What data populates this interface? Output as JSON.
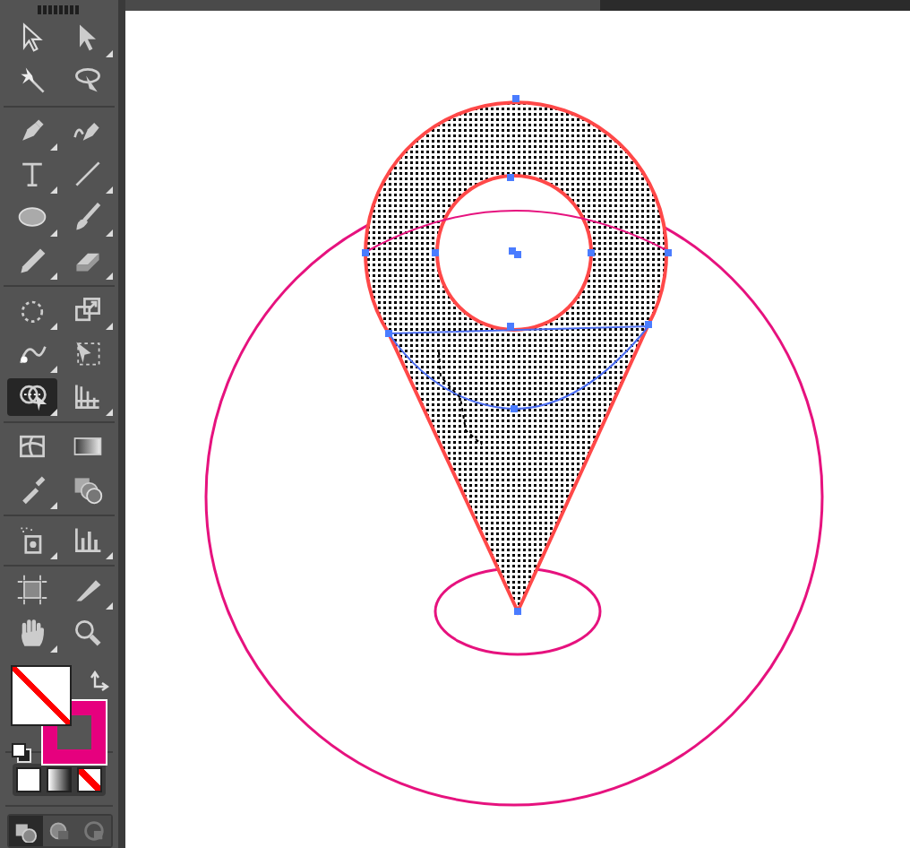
{
  "tool_groups": [
    [
      {
        "kind": "selection",
        "selected": false,
        "flyout": false
      },
      {
        "kind": "direct-selection",
        "selected": false,
        "flyout": true
      },
      {
        "kind": "magic-wand",
        "selected": false,
        "flyout": false
      },
      {
        "kind": "lasso",
        "selected": false,
        "flyout": false
      }
    ],
    [
      {
        "kind": "pen",
        "selected": false,
        "flyout": true
      },
      {
        "kind": "curvature",
        "selected": false,
        "flyout": false
      },
      {
        "kind": "type",
        "selected": false,
        "flyout": true
      },
      {
        "kind": "line",
        "selected": false,
        "flyout": true
      },
      {
        "kind": "ellipse",
        "selected": false,
        "flyout": true
      },
      {
        "kind": "brush",
        "selected": false,
        "flyout": true
      },
      {
        "kind": "pencil",
        "selected": false,
        "flyout": true
      },
      {
        "kind": "eraser",
        "selected": false,
        "flyout": true
      }
    ],
    [
      {
        "kind": "rotate",
        "selected": false,
        "flyout": true
      },
      {
        "kind": "scale",
        "selected": false,
        "flyout": true
      },
      {
        "kind": "puppet-warp",
        "selected": false,
        "flyout": true
      },
      {
        "kind": "free-transform",
        "selected": false,
        "flyout": false
      },
      {
        "kind": "shape-builder",
        "selected": true,
        "flyout": true
      },
      {
        "kind": "perspective-grid",
        "selected": false,
        "flyout": true
      }
    ],
    [
      {
        "kind": "mesh",
        "selected": false,
        "flyout": false
      },
      {
        "kind": "gradient",
        "selected": false,
        "flyout": false
      },
      {
        "kind": "eyedropper",
        "selected": false,
        "flyout": true
      },
      {
        "kind": "blend",
        "selected": false,
        "flyout": false
      }
    ],
    [
      {
        "kind": "symbol-sprayer",
        "selected": false,
        "flyout": true
      },
      {
        "kind": "column-graph",
        "selected": false,
        "flyout": true
      }
    ],
    [
      {
        "kind": "artboard",
        "selected": false,
        "flyout": false
      },
      {
        "kind": "slice",
        "selected": false,
        "flyout": true
      },
      {
        "kind": "hand",
        "selected": false,
        "flyout": true
      },
      {
        "kind": "zoom",
        "selected": false,
        "flyout": false
      }
    ]
  ],
  "fill": {
    "kind": "none",
    "front": true
  },
  "stroke": {
    "kind": "color",
    "color": "#e6007e",
    "front": false
  },
  "color_modes": [
    {
      "kind": "color",
      "selected": false
    },
    {
      "kind": "gradient",
      "selected": false
    },
    {
      "kind": "none",
      "selected": false
    }
  ],
  "screen_modes": [
    {
      "kind": "normal",
      "selected": true
    },
    {
      "kind": "behind",
      "selected": false
    },
    {
      "kind": "inside",
      "selected": false
    }
  ]
}
